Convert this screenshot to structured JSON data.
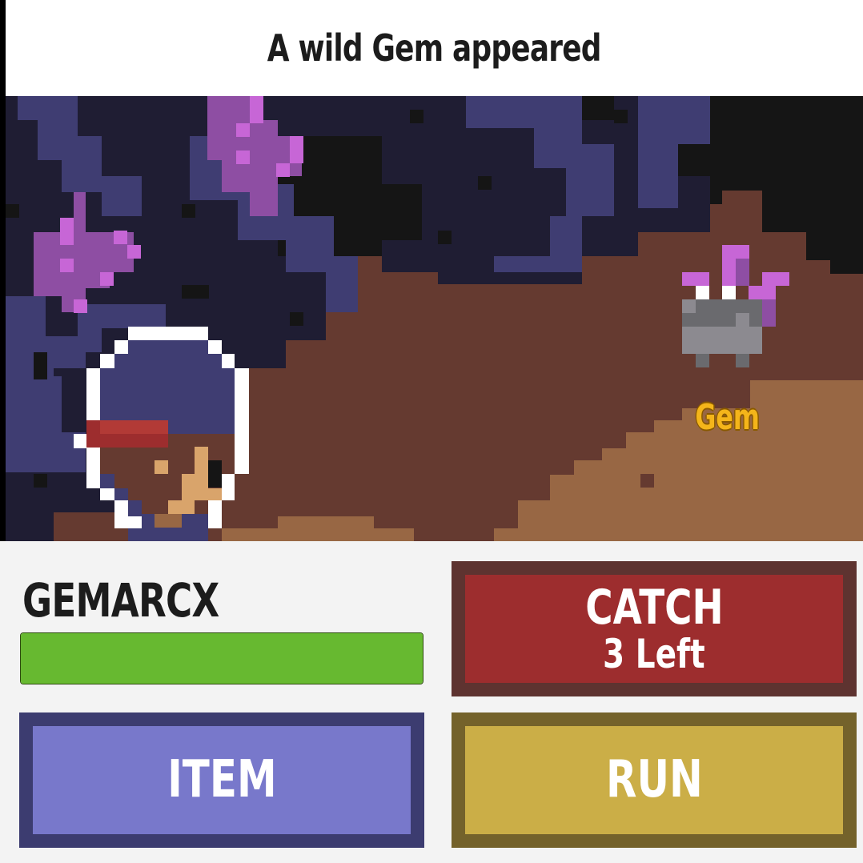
{
  "header": {
    "title": "A wild Gem appeared"
  },
  "battle": {
    "enemy": {
      "name": "Gem"
    }
  },
  "player": {
    "name": "GEMARCX",
    "hp_fraction": 1.0
  },
  "actions": {
    "catch": {
      "label": "CATCH",
      "sublabel": "3 Left"
    },
    "item": {
      "label": "ITEM"
    },
    "run": {
      "label": "RUN"
    }
  },
  "colors": {
    "catch_bg": "#9d2d2e",
    "item_bg": "#7878cb",
    "run_bg": "#cbae47",
    "hp_fill": "#67b930",
    "enemy_name": "#f4b51a"
  }
}
